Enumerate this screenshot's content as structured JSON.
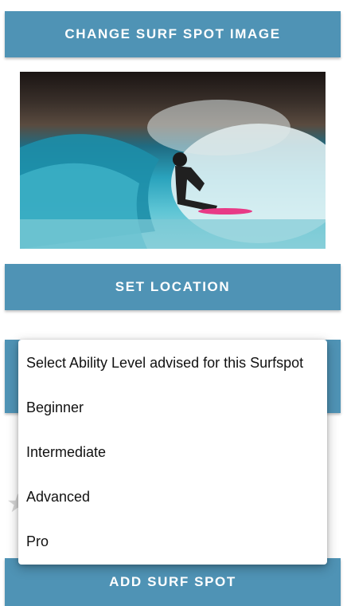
{
  "buttons": {
    "change_image": "CHANGE SURF SPOT IMAGE",
    "set_location": "SET LOCATION",
    "add_surf_spot": "ADD SURF SPOT"
  },
  "image": {
    "description_icon": "surf-spot-image"
  },
  "ability_menu": {
    "items": [
      "Select Ability Level advised for this Surfspot",
      "Beginner",
      "Intermediate",
      "Advanced",
      "Pro"
    ]
  },
  "colors": {
    "accent": "#4f93b5",
    "button_text": "#ffffff"
  }
}
